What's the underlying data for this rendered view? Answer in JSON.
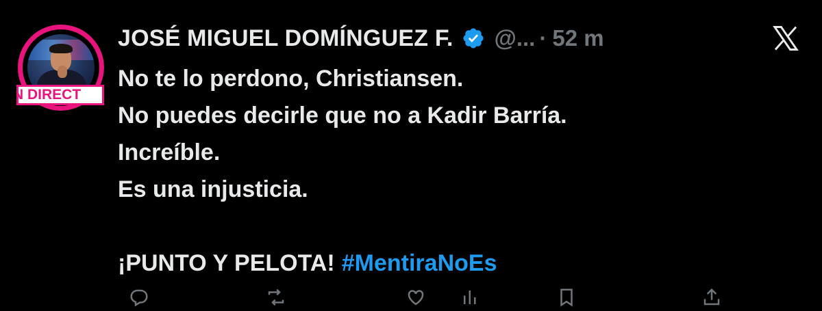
{
  "author": {
    "name": "JOSÉ MIGUEL DOMÍNGUEZ F.",
    "handle": "@...",
    "separator": "·",
    "timestamp": "52 m",
    "verified": true,
    "avatar_banner": "N DIRECT"
  },
  "tweet": {
    "lines": [
      "No te lo perdono, Christiansen.",
      "No puedes decirle que no a Kadir Barría.",
      "Increíble.",
      "Es una injusticia."
    ],
    "closing": "¡PUNTO Y PELOTA!",
    "hashtag": "#MentiraNoEs"
  },
  "icons": {
    "verified": "verified-badge-icon",
    "brand": "x-logo-icon",
    "actions": [
      "reply-icon",
      "repost-icon",
      "like-icon",
      "views-icon",
      "bookmark-icon",
      "share-icon"
    ]
  },
  "colors": {
    "background": "#000000",
    "text": "#e7e9ea",
    "muted": "#71767b",
    "accent": "#1d9bf0",
    "avatar_ring": "#e8137d"
  }
}
